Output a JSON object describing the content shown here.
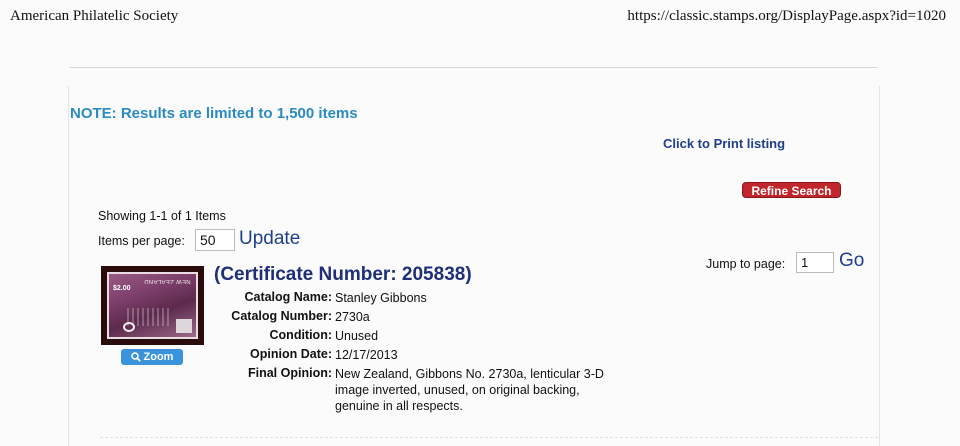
{
  "header": {
    "site_name": "American Philatelic Society",
    "url": "https://classic.stamps.org/DisplayPage.aspx?id=1020"
  },
  "notice": "NOTE: Results are limited to 1,500 items",
  "print_link": "Click to Print listing",
  "refine_button": "Refine Search",
  "pagination": {
    "showing": "Showing 1-1 of 1 Items",
    "items_per_page_label": "Items per page:",
    "items_per_page_value": "50",
    "update_label": "Update",
    "jump_label": "Jump to page:",
    "jump_value": "1",
    "go_label": "Go"
  },
  "result": {
    "title": "(Certificate Number: 205838)",
    "zoom_label": "Zoom",
    "stamp": {
      "value": "$2.00",
      "inverted_text": "NEW ZEALAND"
    },
    "fields": [
      {
        "label": "Catalog Name:",
        "value": "Stanley Gibbons"
      },
      {
        "label": "Catalog Number:",
        "value": "2730a"
      },
      {
        "label": "Condition:",
        "value": "Unused"
      },
      {
        "label": "Opinion Date:",
        "value": "12/17/2013"
      },
      {
        "label": "Final Opinion:",
        "value": "New Zealand, Gibbons No. 2730a, lenticular 3-D image inverted, unused, on original backing, genuine in all respects."
      }
    ]
  },
  "colors": {
    "notice": "#2a8bc0",
    "link": "#1f3f8a",
    "title": "#1e2f78",
    "refine": "#c0262c",
    "zoom": "#3a93db"
  }
}
